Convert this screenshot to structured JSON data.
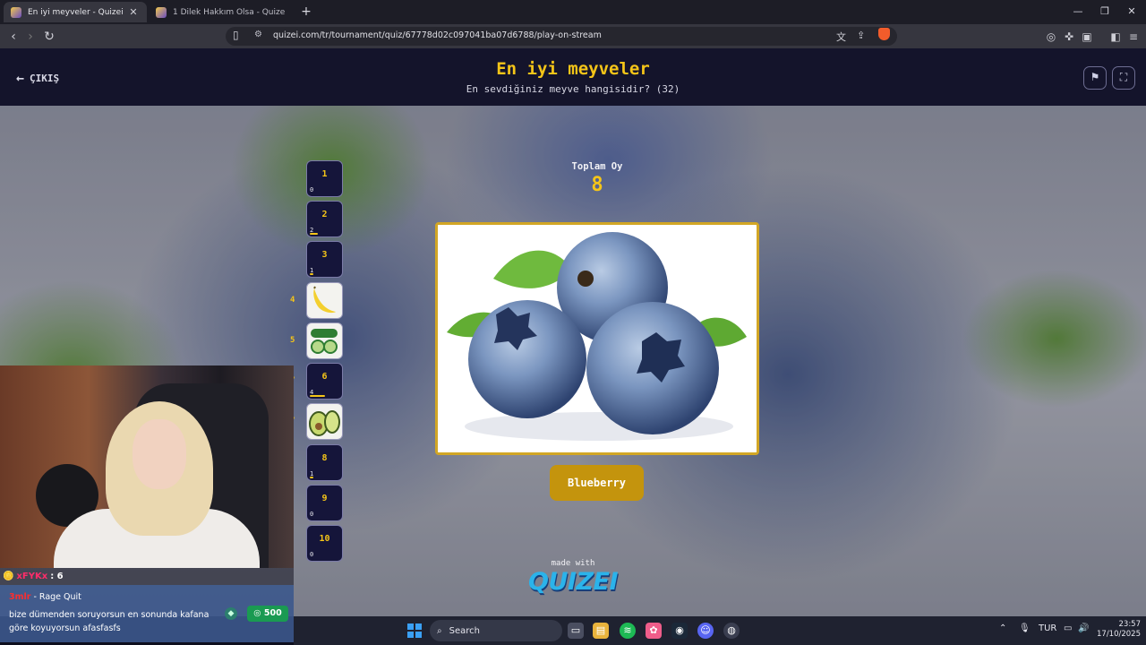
{
  "tabs": [
    {
      "label": "En iyi meyveler - Quizei",
      "active": true
    },
    {
      "label": "1 Dilek Hakkım Olsa - Quizei",
      "active": false
    }
  ],
  "address": {
    "url": "quizei.com/tr/tournament/quiz/67778d02c097041ba07d6788/play-on-stream"
  },
  "header": {
    "exit_label": "ÇIKIŞ",
    "title": "En iyi meyveler",
    "subtitle": "En sevdiğiniz meyve hangisidir? (32)"
  },
  "votes": {
    "caption": "Toplam Oy",
    "total": "8"
  },
  "bracket": [
    {
      "num": "1",
      "count": "0",
      "fill": 0
    },
    {
      "num": "2",
      "count": "2",
      "fill": 0.25
    },
    {
      "num": "3",
      "count": "1",
      "fill": 0.12
    },
    {
      "side": "4",
      "image": "banana"
    },
    {
      "side": "5",
      "image": "cucumber"
    },
    {
      "num": "6",
      "count": "4",
      "fill": 0.5,
      "side": "7"
    },
    {
      "side": "7",
      "image": "avocado"
    },
    {
      "num": "8",
      "count": "1",
      "fill": 0.12
    },
    {
      "num": "9",
      "count": "0",
      "fill": 0
    },
    {
      "num": "10",
      "count": "0",
      "fill": 0
    }
  ],
  "current": {
    "answer": "Blueberry",
    "image": "blueberry"
  },
  "footer": {
    "made_with": "made with",
    "logo": "QUIZEI"
  },
  "stream": {
    "viewer_name": "xFYKx",
    "viewer_count": ": 6",
    "chat_user": "3mlr",
    "chat_title": "- Rage Quit",
    "chat_message": "bize dümenden soruyorsun en sonunda kafana göre koyuyorsun afasfasfs",
    "points": "500"
  },
  "taskbar": {
    "search_label": "Search",
    "lang": "TUR",
    "time": "23:57",
    "date": "17/10/2025"
  },
  "colors": {
    "accent": "#f5c518",
    "header_bg": "#14142b",
    "card_border": "#d2a625",
    "answer_bg": "#c4940d"
  }
}
